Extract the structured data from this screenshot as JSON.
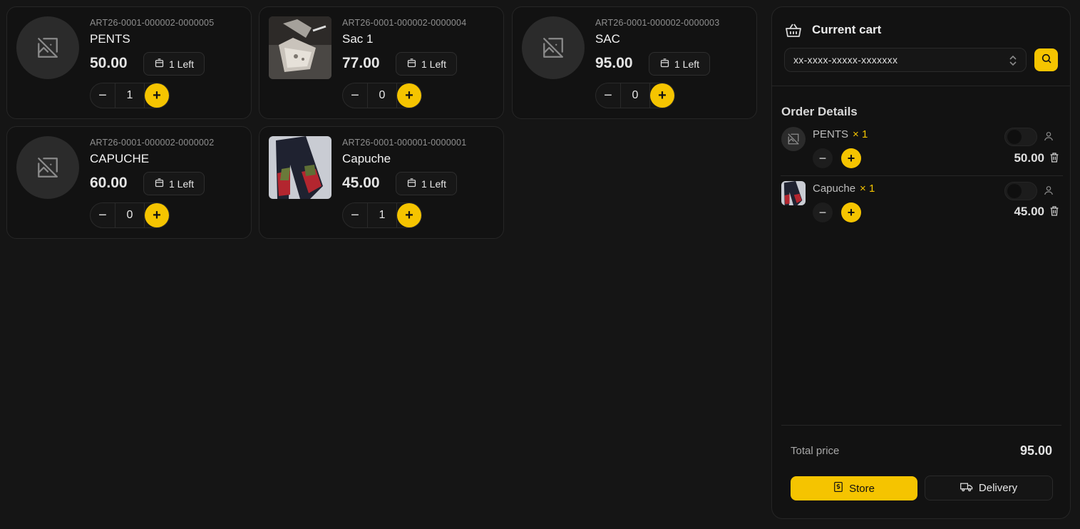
{
  "products": [
    {
      "sku": "ART26-0001-000002-0000005",
      "name": "PENTS",
      "price": "50.00",
      "stock": "1 Left",
      "qty": "1",
      "image": "no-image-icon"
    },
    {
      "sku": "ART26-0001-000002-0000004",
      "name": "Sac 1",
      "price": "77.00",
      "stock": "1 Left",
      "qty": "0",
      "image": "bag-photo"
    },
    {
      "sku": "ART26-0001-000002-0000003",
      "name": "SAC",
      "price": "95.00",
      "stock": "1 Left",
      "qty": "0",
      "image": "no-image-icon"
    },
    {
      "sku": "ART26-0001-000002-0000002",
      "name": "CAPUCHE",
      "price": "60.00",
      "stock": "1 Left",
      "qty": "0",
      "image": "no-image-icon"
    },
    {
      "sku": "ART26-0001-000001-0000001",
      "name": "Capuche",
      "price": "45.00",
      "stock": "1 Left",
      "qty": "1",
      "image": "jeans-photo"
    }
  ],
  "cart": {
    "title": "Current cart",
    "customer_select_value": "xx-xxxx-xxxxx-xxxxxxx",
    "order_details_title": "Order Details",
    "lines": [
      {
        "name": "PENTS",
        "qty": "× 1",
        "price": "50.00"
      },
      {
        "name": "Capuche",
        "qty": "× 1",
        "price": "45.00"
      }
    ],
    "total_label": "Total price",
    "total_value": "95.00",
    "store_label": "Store",
    "delivery_label": "Delivery"
  },
  "colors": {
    "accent": "#f5c400",
    "background": "#151515",
    "card": "#121212"
  }
}
